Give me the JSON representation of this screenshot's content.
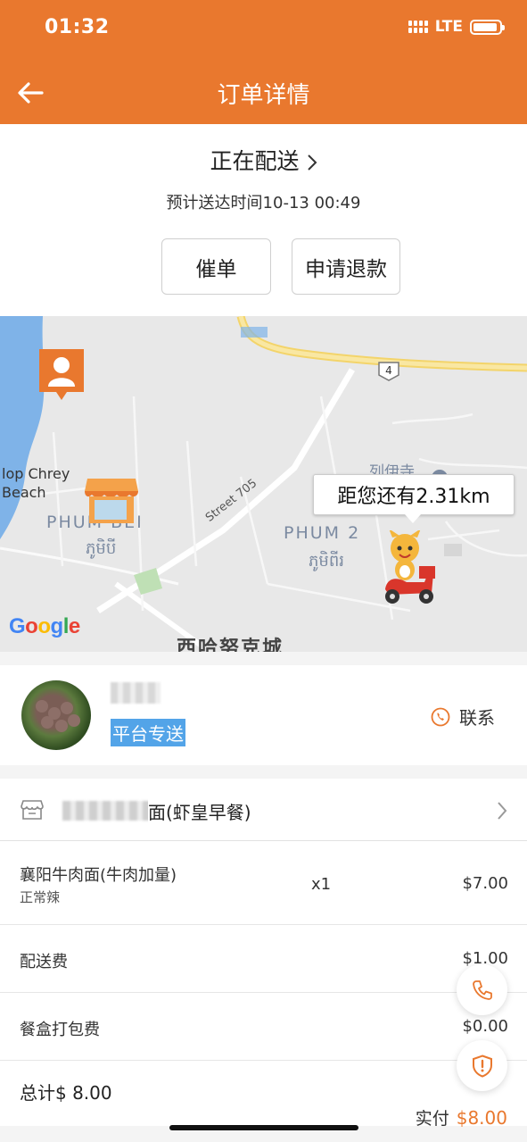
{
  "status_bar": {
    "time": "01:32",
    "network": "LTE"
  },
  "header": {
    "title": "订单详情",
    "back_icon": "back-arrow-icon"
  },
  "status": {
    "label": "正在配送",
    "eta": "预计送达时间10-13 00:49",
    "urge_button": "催单",
    "refund_button": "申请退款"
  },
  "map": {
    "distance_bubble": "距您还有2.31km",
    "labels": {
      "beach": "lop Chrey\nBeach",
      "phum_bei": "PHUM BEI",
      "phum_bei_kh": "ភូមិបី",
      "phum_2": "PHUM 2",
      "phum_2_kh": "ភូមិពីរ",
      "street": "Street 705",
      "temple": "列伊寺",
      "city": "西哈努克城",
      "road_number": "4"
    },
    "google_logo": [
      "G",
      "o",
      "o",
      "g",
      "l",
      "e"
    ]
  },
  "shop": {
    "tag": "平台专送",
    "contact": "联系"
  },
  "order": {
    "store_name": "面(虾皇早餐)",
    "items": [
      {
        "name": "襄阳牛肉面(牛肉加量)",
        "spec": "正常辣",
        "qty": "x1",
        "price": "$7.00"
      }
    ],
    "fees": [
      {
        "name": "配送费",
        "price": "$1.00"
      },
      {
        "name": "餐盒打包费",
        "price": "$0.00"
      }
    ],
    "total": "总计$ 8.00",
    "paid_label": "实付",
    "paid_amount": "$8.00"
  },
  "colors": {
    "brand": "#e9782e",
    "tag": "#53a4e8"
  }
}
